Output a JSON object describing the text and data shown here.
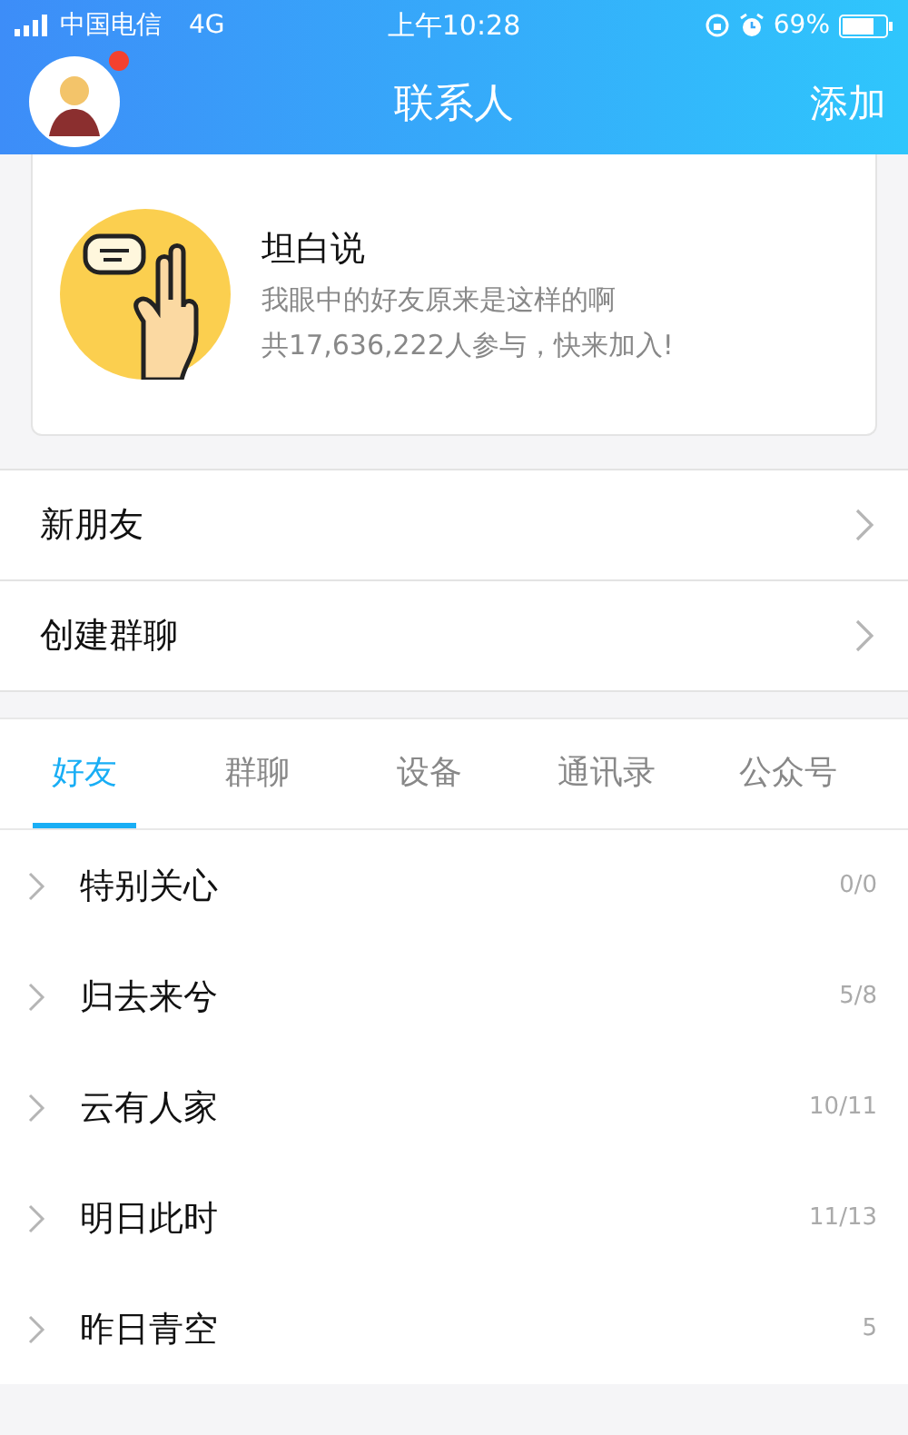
{
  "status_bar": {
    "carrier": "中国电信",
    "network": "4G",
    "time": "上午10:28",
    "battery": "69%"
  },
  "nav": {
    "title": "联系人",
    "action": "添加",
    "avatar_badge": true
  },
  "promo": {
    "title": "坦白说",
    "subtitle": "我眼中的好友原来是这样的啊",
    "participants": "共17,636,222人参与，快来加入!"
  },
  "menu": [
    {
      "label": "新朋友"
    },
    {
      "label": "创建群聊"
    }
  ],
  "tabs": [
    {
      "label": "好友",
      "selected": true
    },
    {
      "label": "群聊",
      "selected": false
    },
    {
      "label": "设备",
      "selected": false
    },
    {
      "label": "通讯录",
      "selected": false
    },
    {
      "label": "公众号",
      "selected": false
    }
  ],
  "groups": [
    {
      "name": "特别关心",
      "count": "0/0"
    },
    {
      "name": "归去来兮",
      "count": "5/8"
    },
    {
      "name": "云有人家",
      "count": "10/11"
    },
    {
      "name": "明日此时",
      "count": "11/13"
    },
    {
      "name": "昨日青空",
      "count": "5"
    }
  ]
}
